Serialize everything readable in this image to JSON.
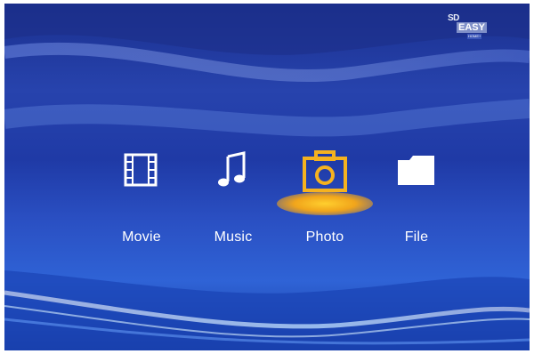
{
  "brand": {
    "line1": "SD",
    "line2": "EASY",
    "line3": "HOME+"
  },
  "menu": {
    "selected": "Photo",
    "items": [
      {
        "label": "Movie",
        "icon": "film-icon"
      },
      {
        "label": "Music",
        "icon": "music-note-icon"
      },
      {
        "label": "Photo",
        "icon": "camera-icon"
      },
      {
        "label": "File",
        "icon": "folder-icon"
      }
    ]
  },
  "colors": {
    "background": "#2743ad",
    "highlight": "#f5b21f",
    "text": "#ffffff"
  }
}
